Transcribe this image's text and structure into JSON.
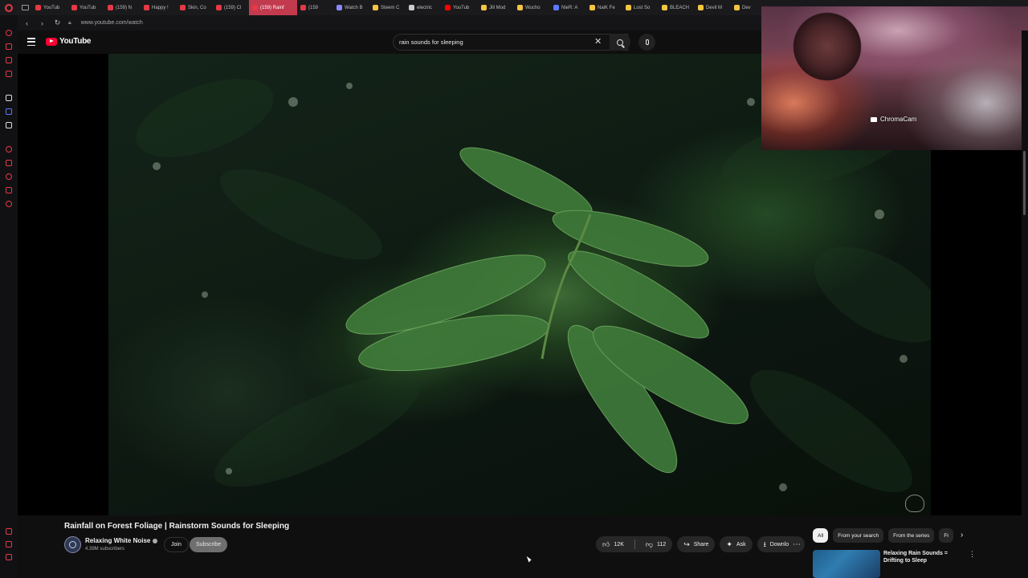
{
  "browser": {
    "tabs": [
      {
        "label": "YouTub",
        "color": "#e53946"
      },
      {
        "label": "YouTub",
        "color": "#e53946"
      },
      {
        "label": "(159) N",
        "color": "#e53946"
      },
      {
        "label": "Happy !",
        "color": "#e53946"
      },
      {
        "label": "Skin, Co",
        "color": "#e53946"
      },
      {
        "label": "(159) Cl",
        "color": "#e53946"
      },
      {
        "label": "(159) Rainf",
        "color": "#e53946",
        "active": true
      },
      {
        "label": "(159",
        "color": "#e53946"
      },
      {
        "label": "Watch B",
        "color": "#8a8aff"
      },
      {
        "label": "Steem C",
        "color": "#f5c542"
      },
      {
        "label": "electric",
        "color": "#cccccc"
      },
      {
        "label": "YouTub",
        "color": "#ff0000"
      },
      {
        "label": "Jill Mod",
        "color": "#f5c542"
      },
      {
        "label": "Wucho",
        "color": "#f5c542"
      },
      {
        "label": "NieR: A",
        "color": "#5a7bff"
      },
      {
        "label": "NaiK Fe",
        "color": "#f5c542"
      },
      {
        "label": "Lost So",
        "color": "#f5c542"
      },
      {
        "label": "BLEACH",
        "color": "#f5c542"
      },
      {
        "label": "Devil M",
        "color": "#f5c542"
      },
      {
        "label": "Dev",
        "color": "#f5c542"
      }
    ],
    "url": "www.youtube.com/watch"
  },
  "masthead": {
    "logo_text": "YouTube",
    "search_value": "rain sounds for sleeping"
  },
  "webcam": {
    "label": "ChromaCam"
  },
  "video": {
    "title": "Rainfall on Forest Foliage | Rainstorm Sounds for Sleeping",
    "channel": "Relaxing White Noise",
    "subscribers": "4.39M subscribers",
    "join_label": "Join",
    "subscribe_label": "Subscribe",
    "likes": "12K",
    "dislikes": "112",
    "share_label": "Share",
    "ask_label": "Ask",
    "download_label": "Download"
  },
  "related": {
    "chips": [
      "All",
      "From your search",
      "From the series",
      "Fr"
    ],
    "items": [
      {
        "title": "Relaxing Rain Sounds = Drifting to Sleep"
      }
    ]
  },
  "colors": {
    "brand_red": "#ff0033",
    "browser_accent": "#e53946",
    "background": "#0f0f0f"
  }
}
